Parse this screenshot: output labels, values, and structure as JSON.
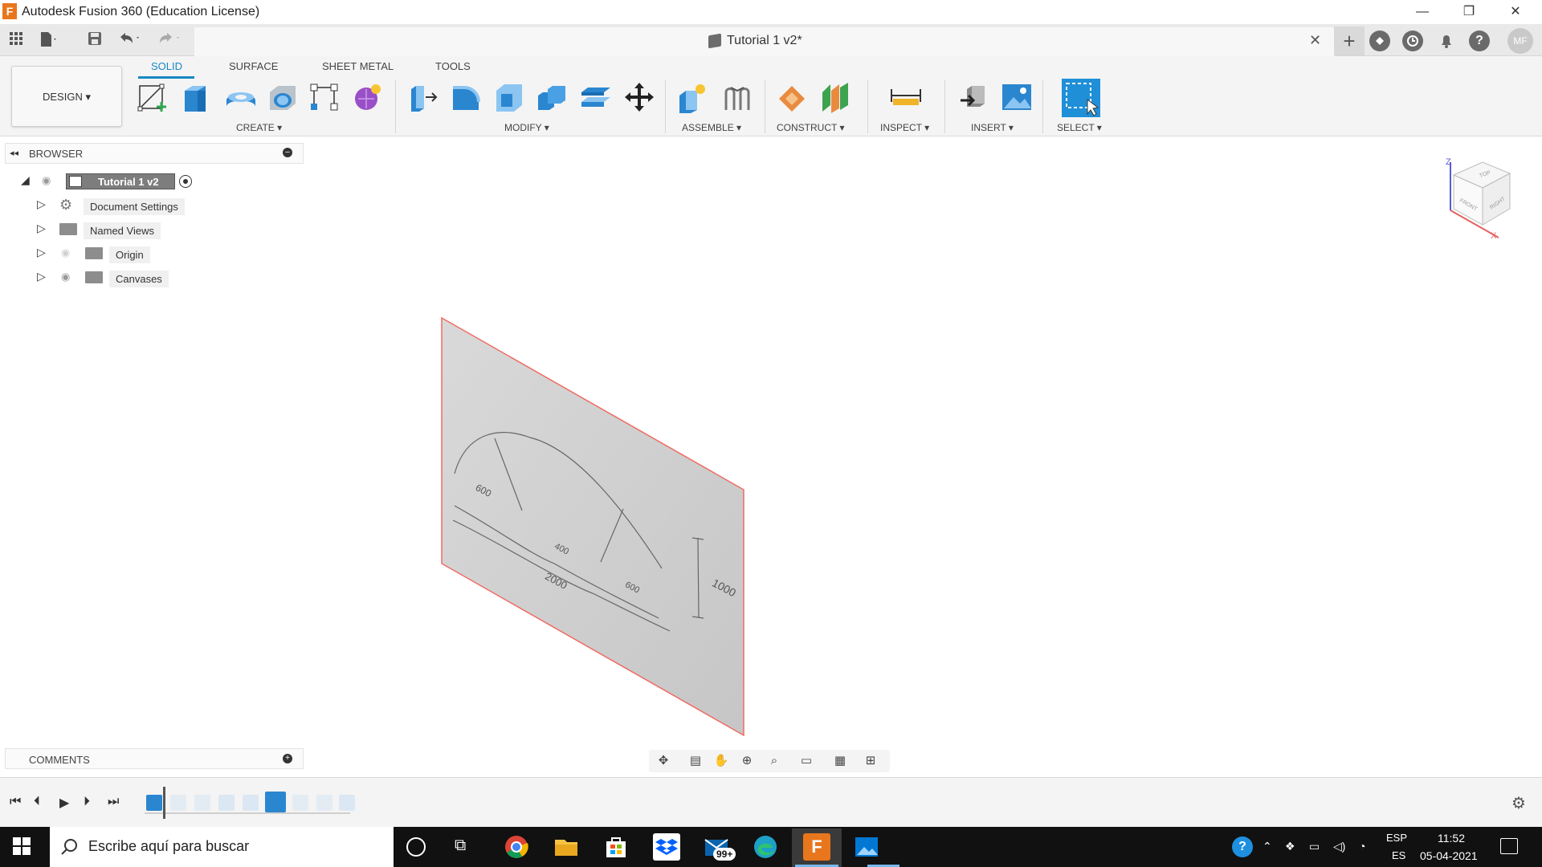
{
  "window": {
    "title": "Autodesk Fusion 360 (Education License)",
    "logo_letter": "F",
    "minimize": "—",
    "restore": "❐",
    "close": "✕"
  },
  "quick_access": {
    "grid_icon": "apps-grid-icon",
    "file_icon": "file-icon",
    "save_icon": "save-icon",
    "undo_icon": "undo-icon",
    "redo_icon": "redo-icon"
  },
  "document_tab": {
    "title": "Tutorial 1 v2*",
    "close": "✕"
  },
  "top_right": {
    "new_tab": "+",
    "user_initials": "MF"
  },
  "workspace": {
    "button_label": "DESIGN ▾"
  },
  "ribbon_tabs": [
    "SOLID",
    "SURFACE",
    "SHEET METAL",
    "TOOLS"
  ],
  "ribbon_groups": {
    "create": "CREATE ▾",
    "modify": "MODIFY ▾",
    "assemble": "ASSEMBLE ▾",
    "construct": "CONSTRUCT ▾",
    "inspect": "INSPECT ▾",
    "insert": "INSERT ▾",
    "select": "SELECT ▾"
  },
  "browser": {
    "title": "BROWSER",
    "root": "Tutorial 1 v2",
    "items": [
      {
        "label": "Document Settings"
      },
      {
        "label": "Named Views"
      },
      {
        "label": "Origin"
      },
      {
        "label": "Canvases"
      }
    ]
  },
  "comments": {
    "title": "COMMENTS"
  },
  "canvas_sketch": {
    "labels": [
      "600",
      "2000",
      "400",
      "600",
      "1000"
    ]
  },
  "viewcube": {
    "faces": [
      "TOP",
      "FRONT",
      "RIGHT"
    ],
    "axes": [
      "Z",
      "X"
    ]
  },
  "taskbar": {
    "search_placeholder": "Escribe aquí para buscar",
    "mail_badge": "99+",
    "lang_top": "ESP",
    "lang_bottom": "ES",
    "time": "11:52",
    "date": "05-04-2021"
  },
  "colors": {
    "accent": "#1787c5",
    "canvas_border": "#ef6b63",
    "fusion_orange": "#e8761d"
  }
}
